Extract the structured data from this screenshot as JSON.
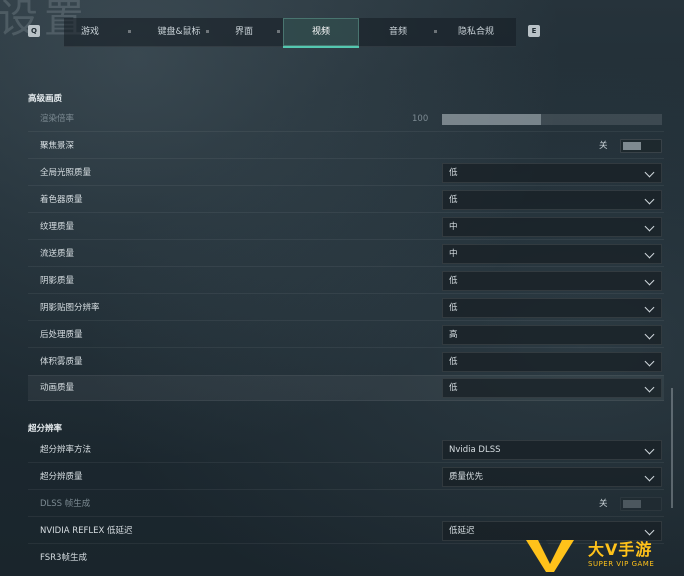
{
  "background_title": "设置",
  "nav": {
    "left_key": "Q",
    "right_key": "E",
    "tabs": [
      {
        "label": "游戏"
      },
      {
        "label": "键盘&鼠标"
      },
      {
        "label": "界面"
      },
      {
        "label": "视频",
        "active": true
      },
      {
        "label": "音频"
      },
      {
        "label": "隐私合规"
      }
    ]
  },
  "sections": {
    "advanced": {
      "title": "高级画质"
    },
    "upscaling": {
      "title": "超分辨率"
    }
  },
  "settings": {
    "render_scale": {
      "label": "渲染倍率",
      "value": "100",
      "fill_percent": 45
    },
    "depth_of_field": {
      "label": "聚焦景深",
      "state": "关"
    },
    "global_illumination": {
      "label": "全局光照质量",
      "value": "低"
    },
    "shader_quality": {
      "label": "着色器质量",
      "value": "低"
    },
    "texture_quality": {
      "label": "纹理质量",
      "value": "中"
    },
    "streaming_quality": {
      "label": "流送质量",
      "value": "中"
    },
    "shadow_quality": {
      "label": "阴影质量",
      "value": "低"
    },
    "shadow_map_resolution": {
      "label": "阴影贴图分辨率",
      "value": "低"
    },
    "post_processing": {
      "label": "后处理质量",
      "value": "高"
    },
    "volumetric_fog": {
      "label": "体积雾质量",
      "value": "低"
    },
    "animation_quality": {
      "label": "动画质量",
      "value": "低"
    },
    "upscaling_method": {
      "label": "超分辨率方法",
      "value": "Nvidia DLSS"
    },
    "upscaling_quality": {
      "label": "超分辨质量",
      "value": "质量优先"
    },
    "dlss_frame_gen": {
      "label": "DLSS 帧生成",
      "state": "关"
    },
    "nvidia_reflex": {
      "label": "NVIDIA REFLEX 低延迟",
      "value": "低延迟"
    },
    "fsr3_frame_gen": {
      "label": "FSR3帧生成"
    }
  },
  "watermark": {
    "text": "大V手游",
    "subtext": "SUPER VIP GAME"
  },
  "colors": {
    "accent": "#54c8b0",
    "brand": "#ffc21a"
  }
}
